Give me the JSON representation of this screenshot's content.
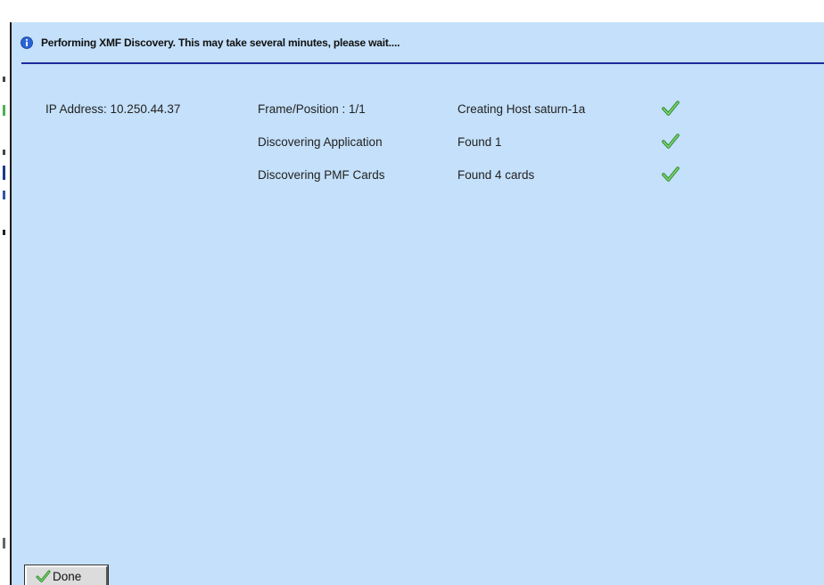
{
  "header": {
    "title": "Performing XMF Discovery. This may take several minutes, please wait....",
    "icon": "info-icon"
  },
  "discovery": {
    "ip_label": "IP Address: 10.250.44.37",
    "rows": [
      {
        "step": "Frame/Position : 1/1",
        "result": "Creating Host saturn-1a",
        "status_icon": "check-icon"
      },
      {
        "step": "Discovering Application",
        "result": "Found 1",
        "status_icon": "check-icon"
      },
      {
        "step": "Discovering PMF Cards",
        "result": "Found 4 cards",
        "status_icon": "check-icon"
      }
    ]
  },
  "footer": {
    "done_label": "Done",
    "done_icon": "check-icon"
  },
  "colors": {
    "dialog_bg": "#c4e0fa",
    "header_rule": "#1c2a9c",
    "check_green": "#4cb648",
    "info_blue": "#2a62d8"
  }
}
